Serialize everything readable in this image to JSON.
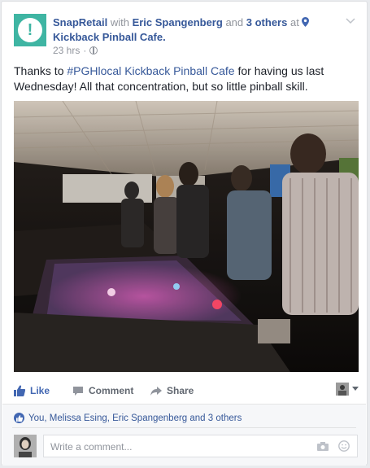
{
  "post": {
    "page_name": "SnapRetail",
    "with_word": "with",
    "tagged_person": "Eric Spangenberg",
    "and_word": "and",
    "tagged_others": "3 others",
    "at_word": "at",
    "location": "Kickback Pinball Cafe.",
    "timestamp": "23 hrs",
    "text_before": "Thanks to ",
    "hashtag": "#PGHlocal",
    "space": " ",
    "mention": "Kickback Pinball Cafe",
    "text_after": " for having us last Wednesday! All that concentration, but so little pinball skill."
  },
  "actions": {
    "like": "Like",
    "comment": "Comment",
    "share": "Share"
  },
  "likes": {
    "summary": "You, Melissa Esing, Eric Spangenberg and 3 others"
  },
  "comment_box": {
    "placeholder": "Write a comment..."
  },
  "colors": {
    "brand": "#3fb5a3",
    "link": "#365899",
    "like_active": "#4267b2"
  }
}
